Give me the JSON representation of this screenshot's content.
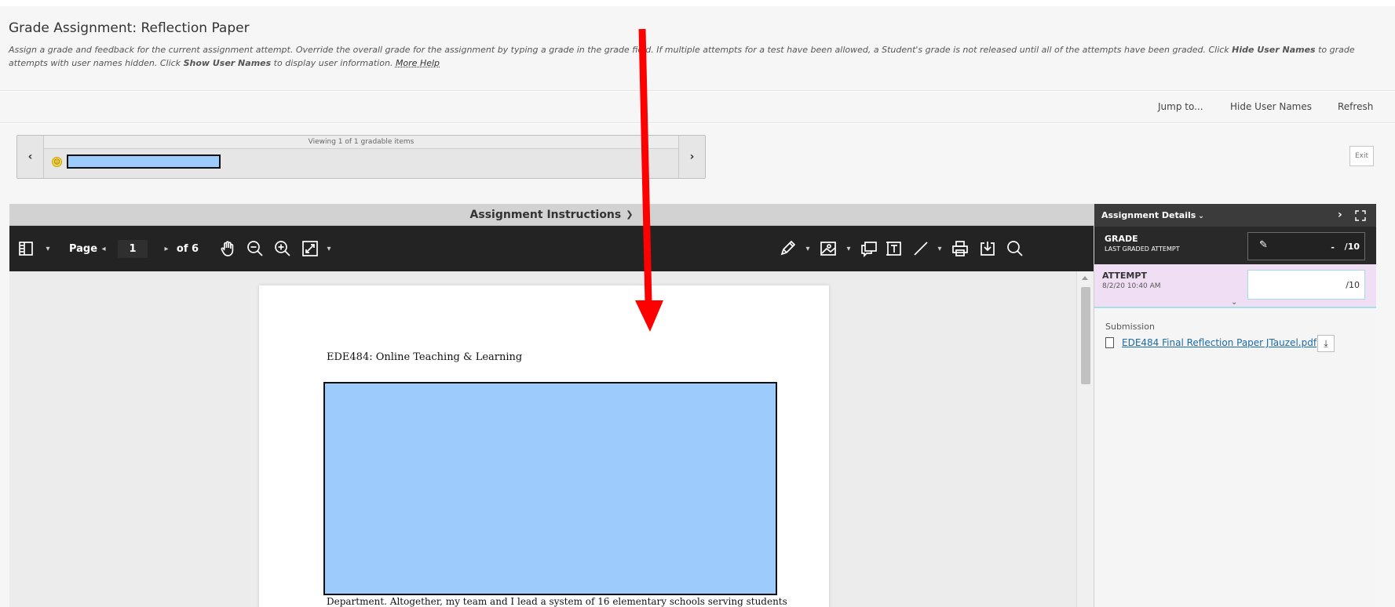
{
  "header": {
    "title": "Grade Assignment: Reflection Paper",
    "instructions_part1": "Assign a grade and feedback for the current assignment attempt. Override the overall grade for the assignment by typing a grade in the grade field. If multiple attempts for a test have been allowed, a Student's grade is not released until all of the attempts have been graded. Click ",
    "hide_user_names_bold": "Hide User Names",
    "instructions_part2": " to grade attempts with user names hidden. Click ",
    "show_user_names_bold": "Show User Names",
    "instructions_part3": " to display user information. ",
    "more_help": "More Help"
  },
  "actions": {
    "jump_to": "Jump to...",
    "hide_user_names": "Hide User Names",
    "refresh": "Refresh"
  },
  "navigator": {
    "count_text": "Viewing 1 of 1 gradable items",
    "prev_glyph": "‹",
    "next_glyph": "›"
  },
  "exit_label": "Exit",
  "viewer": {
    "instructions_bar": "Assignment Instructions",
    "page_label": "Page",
    "page_current": "1",
    "page_total": "of 6"
  },
  "document": {
    "course_title": "EDE484: Online Teaching & Learning",
    "body_line": "Department.  Altogether, my team and I lead a system of 16 elementary schools serving students"
  },
  "side_panel": {
    "title": "Assignment Details",
    "grade_label": "GRADE",
    "grade_sublabel": "LAST GRADED ATTEMPT",
    "grade_value": "-",
    "grade_out_of": "/10",
    "attempt_label": "ATTEMPT",
    "attempt_date": "8/2/20 10:40 AM",
    "attempt_out_of": "/10",
    "submission_label": "Submission",
    "file_name": "EDE484 Final Reflection Paper JTauzel.pdf"
  },
  "colors": {
    "redaction_fill": "#9ccbfc",
    "annotation_arrow": "#ff0000",
    "toolbar_bg": "#232323",
    "attempt_bg": "#f0def4"
  }
}
